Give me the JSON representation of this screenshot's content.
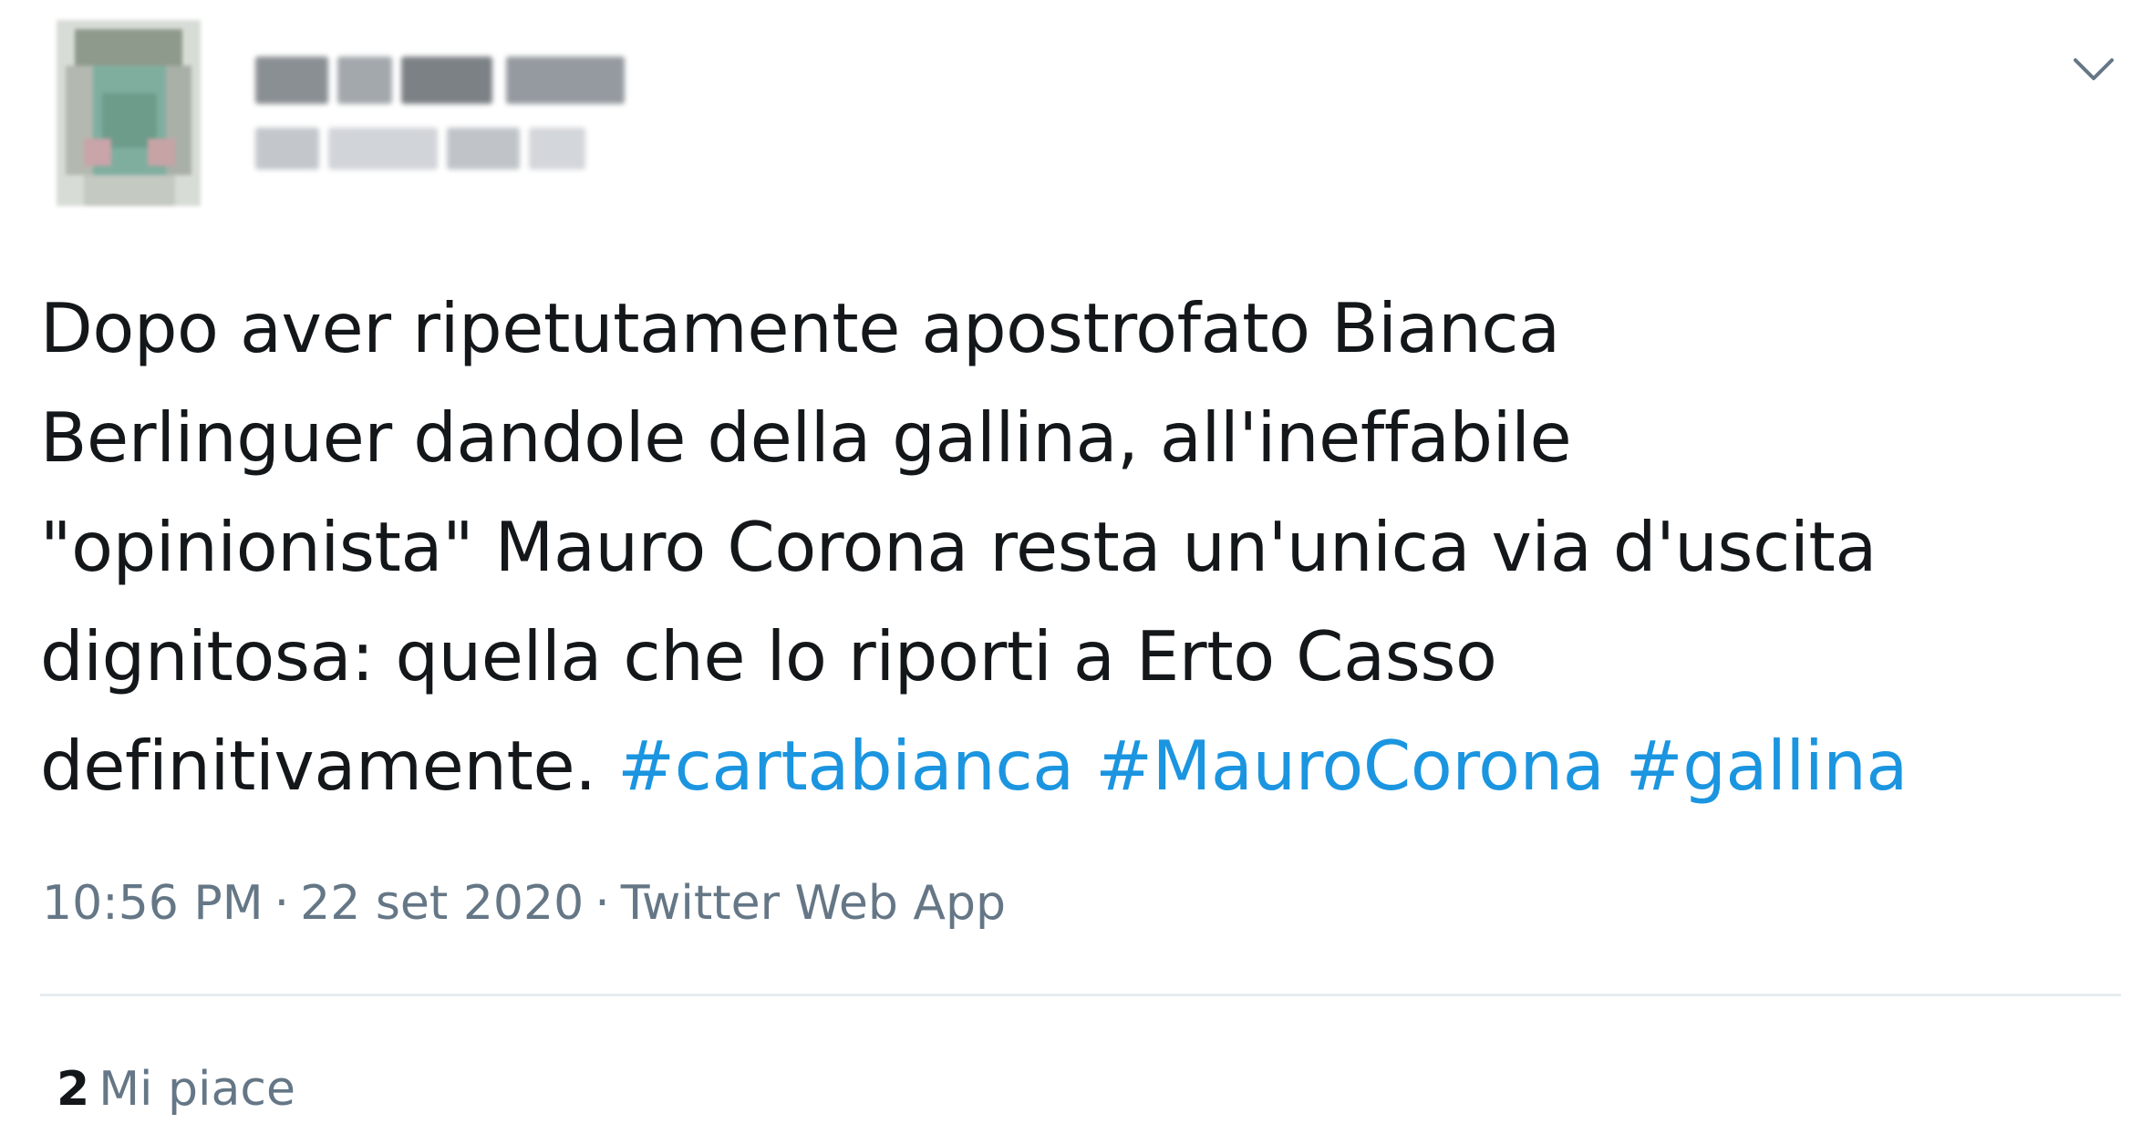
{
  "tweet": {
    "text_lines": [
      "Dopo aver ripetutamente apostrofato Bianca",
      "Berlinguer dandole della gallina, all'ineffabile",
      "\"opinionista\" Mauro Corona resta un'unica via d'uscita",
      "dignitosa: quella che lo riporti a Erto Casso",
      "definitivamente."
    ],
    "hashtags": [
      "#cartabianca",
      "#MauroCorona",
      "#gallina"
    ],
    "time": "10:56 PM",
    "date": "22 set 2020",
    "source": "Twitter Web App",
    "separator": "·",
    "likes_count": "2",
    "likes_label": "Mi piace"
  },
  "icons": {
    "menu": "chevron-down-icon"
  },
  "colors": {
    "text": "#14171a",
    "hashtag": "#1b95e0",
    "meta": "#657786",
    "divider": "#e6ecf0"
  }
}
